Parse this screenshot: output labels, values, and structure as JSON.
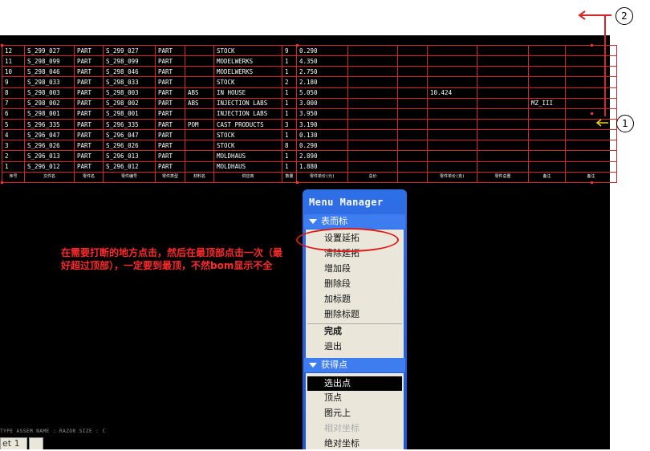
{
  "bom": {
    "rows": [
      [
        "12",
        "S_299_027",
        "PART",
        "S_299_027",
        "PART",
        "",
        "STOCK",
        "9",
        "0.290",
        "",
        "",
        "",
        "",
        "",
        ""
      ],
      [
        "11",
        "S_298_099",
        "PART",
        "S_298_099",
        "PART",
        "",
        "MODELWERKS",
        "1",
        "4.350",
        "",
        "",
        "",
        "",
        "",
        ""
      ],
      [
        "10",
        "S_298_046",
        "PART",
        "S_298_046",
        "PART",
        "",
        "MODELWERKS",
        "1",
        "2.750",
        "",
        "",
        "",
        "",
        "",
        ""
      ],
      [
        "9",
        "S_298_033",
        "PART",
        "S_298_033",
        "PART",
        "",
        "STOCK",
        "2",
        "2.180",
        "",
        "",
        "",
        "",
        "",
        ""
      ],
      [
        "8",
        "S_298_003",
        "PART",
        "S_298_003",
        "PART",
        "ABS",
        "IN HOUSE",
        "1",
        "5.050",
        "",
        "",
        "10.424",
        "",
        "",
        ""
      ],
      [
        "7",
        "S_298_002",
        "PART",
        "S_298_002",
        "PART",
        "ABS",
        "INJECTION LABS",
        "1",
        "3.000",
        "",
        "",
        "",
        "",
        "MZ_III",
        ""
      ],
      [
        "6",
        "S_298_001",
        "PART",
        "S_298_001",
        "PART",
        "",
        "INJECTION LABS",
        "1",
        "3.950",
        "",
        "",
        "",
        "",
        "",
        ""
      ],
      [
        "5",
        "S_296_335",
        "PART",
        "S_296_335",
        "PART",
        "POM",
        "CAST PRODUCTS",
        "3",
        "3.190",
        "",
        "",
        "",
        "",
        "",
        ""
      ],
      [
        "4",
        "S_296_047",
        "PART",
        "S_296_047",
        "PART",
        "",
        "STOCK",
        "1",
        "0.130",
        "",
        "",
        "",
        "",
        "",
        ""
      ],
      [
        "3",
        "S_296_026",
        "PART",
        "S_296_026",
        "PART",
        "",
        "STOCK",
        "8",
        "0.290",
        "",
        "",
        "",
        "",
        "",
        ""
      ],
      [
        "2",
        "S_296_013",
        "PART",
        "S_296_013",
        "PART",
        "",
        "MOLDHAUS",
        "1",
        "2.890",
        "",
        "",
        "",
        "",
        "",
        ""
      ],
      [
        "1",
        "S_296_012",
        "PART",
        "S_296_012",
        "PART",
        "",
        "MOLDHAUS",
        "1",
        "1.880",
        "",
        "",
        "",
        "",
        "",
        ""
      ]
    ],
    "header": [
      "序号",
      "文件名",
      "零件名",
      "零件编号",
      "零件类型",
      "材料名",
      "供应商",
      "数量",
      "零件单价(元)",
      "总价",
      "",
      "零件单价(克)",
      "零件总重",
      "备注",
      "备注"
    ]
  },
  "status_text": "TYPE  ASSEM  NAME : RAZOR  SIZE : C",
  "tab_label": "et 1",
  "note_text": "在需要打断的地方点击，然后在最顶部点击一次（最好超过顶部），一定要到最顶，不然bom显示不全",
  "menu": {
    "title": "Menu Manager",
    "section1": "表而标",
    "section1_items": [
      "设置延拓",
      "清除延拓",
      "增加段",
      "删除段",
      "加标题",
      "删除标题"
    ],
    "section1_actions": [
      "完成",
      "退出"
    ],
    "section2": "获得点",
    "section2_items": [
      "选出点",
      "顶点",
      "图元上",
      "相对坐标",
      "绝对坐标"
    ]
  },
  "callouts": [
    "1",
    "2"
  ],
  "colors": {
    "grid": "#d4262a",
    "note": "#ff2a2a",
    "menu_blue": "#2f6fe6"
  }
}
